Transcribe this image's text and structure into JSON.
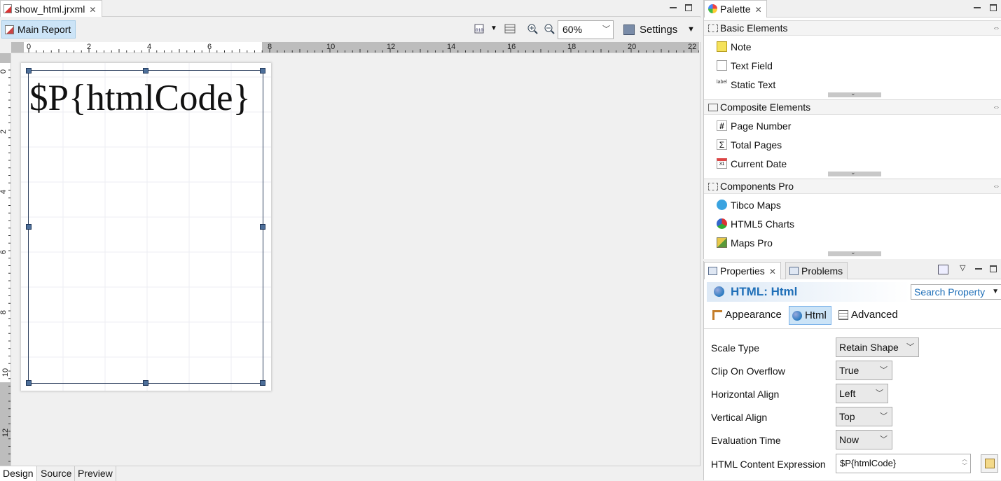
{
  "editor": {
    "file_tab": "show_html.jrxml",
    "main_report": "Main Report",
    "zoom": "60%",
    "settings": "Settings",
    "hruler_labels": [
      "0",
      "2",
      "4",
      "6",
      "8",
      "10",
      "12",
      "14",
      "16",
      "18",
      "20",
      "22"
    ],
    "vruler_labels": [
      "0",
      "2",
      "4",
      "6",
      "8",
      "10",
      "12"
    ],
    "design_expression": "$P{htmlCode}",
    "bottom_tabs": [
      "Design",
      "Source",
      "Preview"
    ]
  },
  "palette": {
    "tab": "Palette",
    "groups": [
      {
        "title": "Basic Elements",
        "items": [
          "Note",
          "Text Field",
          "Static Text"
        ]
      },
      {
        "title": "Composite Elements",
        "items": [
          "Page Number",
          "Total Pages",
          "Current Date"
        ]
      },
      {
        "title": "Components Pro",
        "items": [
          "Tibco Maps",
          "HTML5 Charts",
          "Maps Pro"
        ]
      }
    ]
  },
  "properties": {
    "tab_properties": "Properties",
    "tab_problems": "Problems",
    "title": "HTML: Html",
    "search": "Search Property",
    "section_tabs": [
      "Appearance",
      "Html",
      "Advanced"
    ],
    "rows": [
      {
        "label": "Scale Type",
        "value": "Retain Shape"
      },
      {
        "label": "Clip On Overflow",
        "value": "True"
      },
      {
        "label": "Horizontal Align",
        "value": "Left"
      },
      {
        "label": "Vertical Align",
        "value": "Top"
      },
      {
        "label": "Evaluation Time",
        "value": "Now"
      },
      {
        "label": "HTML Content Expression",
        "value": "$P{htmlCode}"
      }
    ]
  },
  "colors": {
    "accent": "#1f6fb8",
    "selection": "#cce4f7",
    "band_border": "#2a3d5c"
  }
}
